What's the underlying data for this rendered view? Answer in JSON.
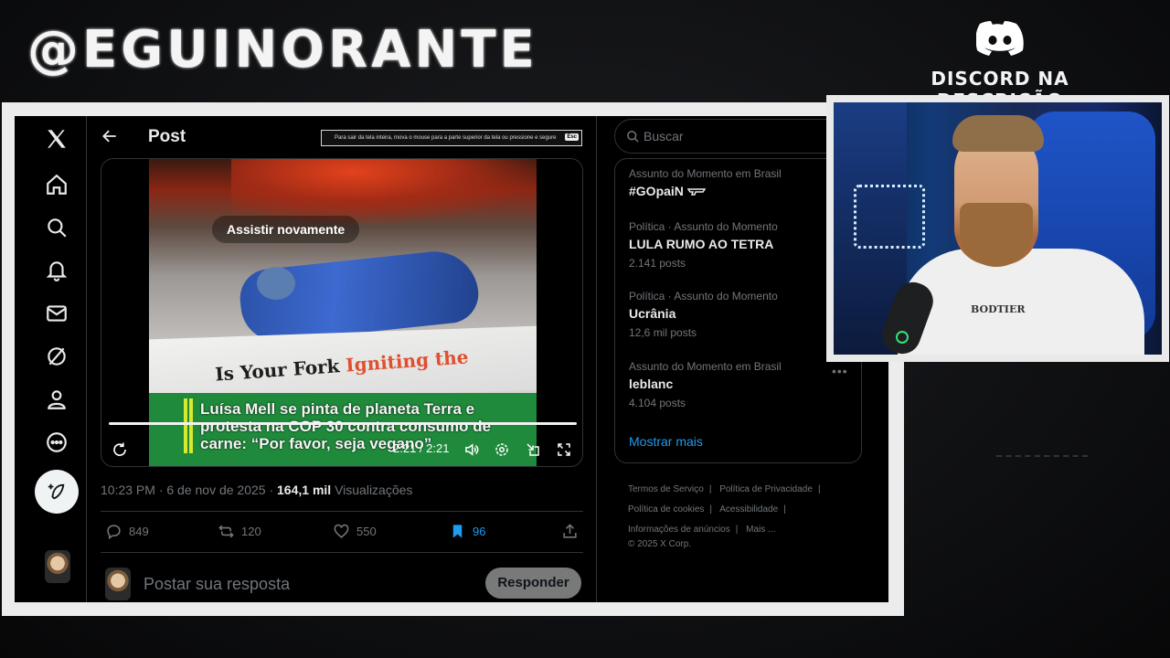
{
  "overlay": {
    "channel_handle": "@EGUINORANTE",
    "discord_text": "DISCORD NA DESCRIÇÃO"
  },
  "header": {
    "title": "Post",
    "fullscreen_notice": "Para sair da tela inteira, mova o mouse para a parte superior da tela ou pressione e segure",
    "esc_key": "Esc"
  },
  "video": {
    "replay_label": "Assistir novamente",
    "time": "2:21 / 2:21",
    "progress": 1.0,
    "banner_text_dark": "Is Your Fork",
    "banner_text_red": "Igniting the",
    "caption": "Luísa Mell se pinta de planeta Terra e protesta na COP 30 contra consumo de carne: “Por favor, seja vegano”"
  },
  "post": {
    "timestamp": "10:23 PM · 6 de nov de 2025 ·",
    "views_count": "164,1 mil",
    "views_label": "Visualizações",
    "replies": "849",
    "reposts": "120",
    "likes": "550",
    "bookmarks": "96"
  },
  "reply": {
    "placeholder": "Postar sua resposta",
    "button": "Responder"
  },
  "search": {
    "placeholder": "Buscar"
  },
  "trends": [
    {
      "context": "Assunto do Momento em Brasil",
      "name": "#GOpaiN",
      "count": ""
    },
    {
      "context": "Política · Assunto do Momento",
      "name": "LULA RUMO AO TETRA",
      "count": "2.141 posts"
    },
    {
      "context": "Política · Assunto do Momento",
      "name": "Ucrânia",
      "count": "12,6 mil posts"
    },
    {
      "context": "Assunto do Momento em Brasil",
      "name": "leblanc",
      "count": "4.104 posts"
    }
  ],
  "show_more": "Mostrar mais",
  "footer": {
    "links": [
      "Termos de Serviço",
      "Política de Privacidade",
      "Política de cookies",
      "Acessibilidade",
      "Informações de anúncios",
      "Mais ..."
    ],
    "copyright": "© 2025 X Corp."
  },
  "webcam": {
    "mic_brand": "BODTIER"
  },
  "colors": {
    "accent": "#1d9bf0",
    "background": "#000000",
    "text": "#e7e9ea",
    "muted": "#71767b"
  }
}
